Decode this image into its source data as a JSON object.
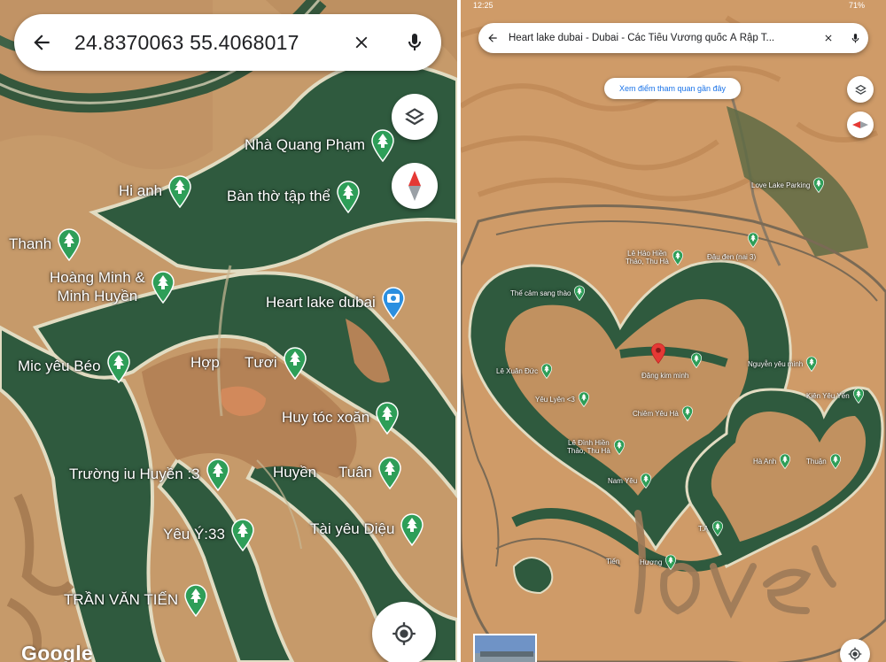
{
  "left": {
    "search": {
      "query": "24.8370063 55.4068017",
      "back_icon": "arrow-left-icon",
      "clear_icon": "close-icon",
      "mic_icon": "mic-icon"
    },
    "controls": {
      "layers_icon": "layers-icon",
      "compass_icon": "compass-icon",
      "locate_icon": "my-location-icon"
    },
    "logo": "Google",
    "places": [
      {
        "label": "Nhà Quang Phạm",
        "icon": "tree-pin-icon"
      },
      {
        "label": "Hi anh",
        "icon": "tree-pin-icon"
      },
      {
        "label": "Bàn thờ tập thể",
        "icon": "tree-pin-icon"
      },
      {
        "label": "Thanh",
        "icon": "tree-pin-icon"
      },
      {
        "label": "Hoàng Minh &",
        "label2": "Minh Huyền",
        "icon": "tree-pin-icon"
      },
      {
        "label": "Heart lake dubai",
        "icon": "camera-pin-icon"
      },
      {
        "label": "Mic yêu Béo",
        "icon": "tree-pin-icon"
      },
      {
        "label": "Hợp"
      },
      {
        "label": "Tươi",
        "icon": "tree-pin-icon"
      },
      {
        "label": "Huy tóc xoăn",
        "icon": "tree-pin-icon"
      },
      {
        "label": "Trường iu Huyền :3",
        "icon": "tree-pin-icon"
      },
      {
        "label": "Huyền"
      },
      {
        "label": "Tuân",
        "icon": "tree-pin-icon"
      },
      {
        "label": "Yêu Ý:33",
        "icon": "tree-pin-icon"
      },
      {
        "label": "Tài yêu Diệu",
        "icon": "tree-pin-icon"
      },
      {
        "label": "TRẦN VĂN TIẾN",
        "icon": "tree-pin-icon"
      }
    ]
  },
  "right": {
    "status": {
      "time": "12:25",
      "battery": "71%"
    },
    "search": {
      "query": "Heart lake dubai - Dubai - Các Tiểu Vương quốc Ả Rập T...",
      "back_icon": "arrow-left-icon",
      "clear_icon": "close-icon",
      "mic_icon": "mic-icon"
    },
    "nearby_button": "Xem điểm tham quan gần đây",
    "controls": {
      "layers_icon": "layers-icon",
      "compass_icon": "compass-icon",
      "locate_icon": "my-location-icon"
    },
    "selected_pin_icon": "red-location-pin-icon",
    "places": [
      {
        "label": "Love Lake Parking",
        "icon": "tree-pin-icon"
      },
      {
        "label": "Lê Hảo Hiền",
        "label2": "Thảo, Thu Hà",
        "icon": "tree-pin-icon"
      },
      {
        "label": "Đậu đen (nai 3)"
      },
      {
        "label": "",
        "icon": "tree-pin-icon"
      },
      {
        "label": "Thế cảm sang thào",
        "icon": "tree-pin-icon"
      },
      {
        "label": "Lê Xuân Đức",
        "icon": "tree-pin-icon"
      },
      {
        "label": "",
        "icon": "tree-pin-icon"
      },
      {
        "label": "Đặng kim minh"
      },
      {
        "label": "Nguyễn yêu minh",
        "icon": "tree-pin-icon"
      },
      {
        "label": "Yêu Lyên <3",
        "icon": "tree-pin-icon"
      },
      {
        "label": "Kiên Yêu Yến",
        "icon": "tree-pin-icon"
      },
      {
        "label": "Chiêm Yêu Hà",
        "icon": "tree-pin-icon"
      },
      {
        "label": "Lê Đình Hiền",
        "label2": "Thảo, Thu Hà",
        "icon": "tree-pin-icon"
      },
      {
        "label": "Hà Anh",
        "icon": "tree-pin-icon"
      },
      {
        "label": "Thuận",
        "icon": "tree-pin-icon"
      },
      {
        "label": "Nam Yêu",
        "icon": "tree-pin-icon"
      },
      {
        "label": "T.A",
        "icon": "tree-pin-icon"
      },
      {
        "label": "Tiến"
      },
      {
        "label": "Hương",
        "icon": "tree-pin-icon"
      }
    ]
  },
  "colors": {
    "sand": "#c69a6a",
    "sand_dark": "#b48256",
    "lake": "#2f5a3e",
    "lake_dark": "#264b33",
    "rim": "#e2dcc2",
    "pin_green": "#2e9e58",
    "pin_blue": "#2b8fe0",
    "pin_red": "#e53935",
    "link_blue": "#1a73e8"
  }
}
